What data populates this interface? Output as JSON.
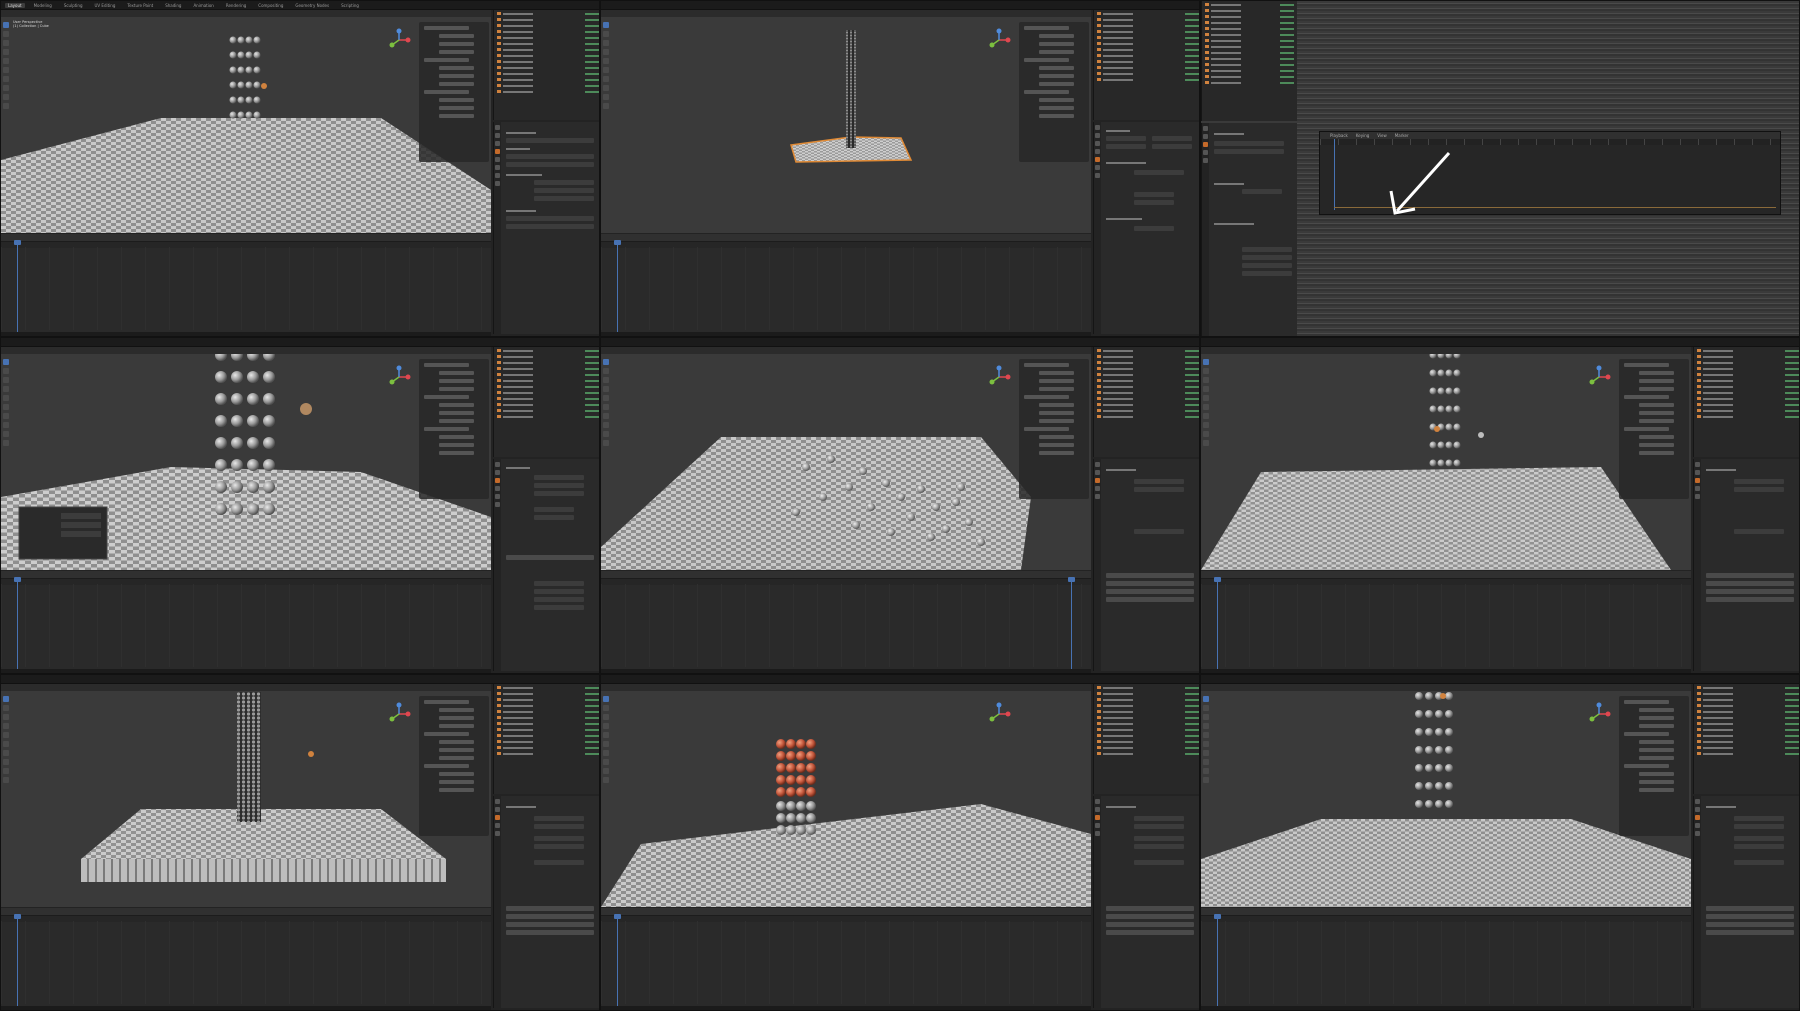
{
  "app": {
    "workspaces": [
      "Layout",
      "Modeling",
      "Sculpting",
      "UV Editing",
      "Texture Paint",
      "Shading",
      "Animation",
      "Rendering",
      "Compositing",
      "Geometry Nodes",
      "Scripting"
    ],
    "active_workspace": "Layout"
  },
  "viewport": {
    "overlay_lines": "User Perspective\n(1) Collection | Cube"
  },
  "timeline": {
    "menu": [
      "Playback",
      "Keying",
      "View",
      "Marker"
    ]
  },
  "colors": {
    "accent": "#4772b3",
    "object_orange": "#d0823e",
    "highlight_red": "#c2553a"
  },
  "panels": [
    {
      "id": "p1",
      "scene": "sphere-column-floor"
    },
    {
      "id": "p2",
      "scene": "tall-column-small-plane"
    },
    {
      "id": "p3",
      "scene": "timeline-zoom-arrow"
    },
    {
      "id": "p4",
      "scene": "sphere-stack-closeup"
    },
    {
      "id": "p5",
      "scene": "scattered-spheres"
    },
    {
      "id": "p6",
      "scene": "column-with-props"
    },
    {
      "id": "p7",
      "scene": "column-on-blocks"
    },
    {
      "id": "p8",
      "scene": "red-selected-column"
    },
    {
      "id": "p9",
      "scene": "column-wide-floor"
    }
  ]
}
